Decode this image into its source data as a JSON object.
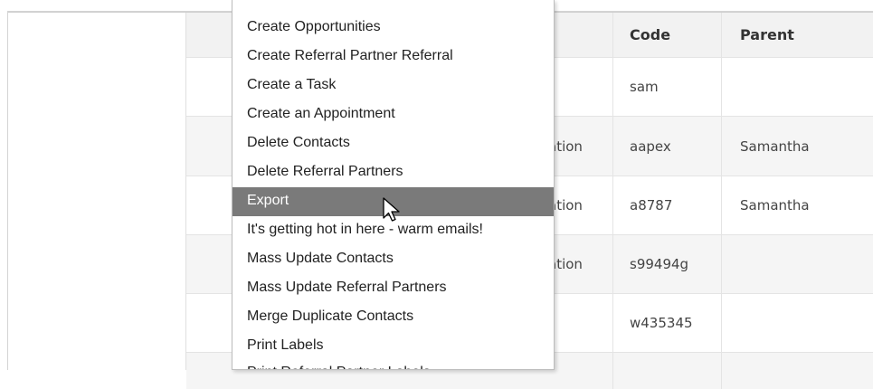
{
  "table": {
    "headers": {
      "code": "Code",
      "parent": "Parent"
    },
    "rows": [
      {
        "name_fragment": "",
        "code": "sam",
        "parent": ""
      },
      {
        "name_fragment": "ation",
        "code": "aapex",
        "parent": "Samantha"
      },
      {
        "name_fragment": "ation",
        "code": "a8787",
        "parent": "Samantha"
      },
      {
        "name_fragment": "ation",
        "code": "s99494g",
        "parent": ""
      },
      {
        "name_fragment": "",
        "code": "w435345",
        "parent": ""
      }
    ]
  },
  "menu": {
    "items": [
      "Create Opportunities",
      "Create Referral Partner Referral",
      "Create a Task",
      "Create an Appointment",
      "Delete Contacts",
      "Delete Referral Partners",
      "Export",
      "It's getting hot in here - warm emails!",
      "Mass Update Contacts",
      "Mass Update Referral Partners",
      "Merge Duplicate Contacts",
      "Print Labels",
      "Print Referral Partner Labels"
    ],
    "active_item": "Export"
  },
  "colors": {
    "menu_highlight": "#7a7a7a",
    "header_bg": "#f2f2f2"
  },
  "icons": {
    "cursor": "mouse-pointer-icon"
  }
}
